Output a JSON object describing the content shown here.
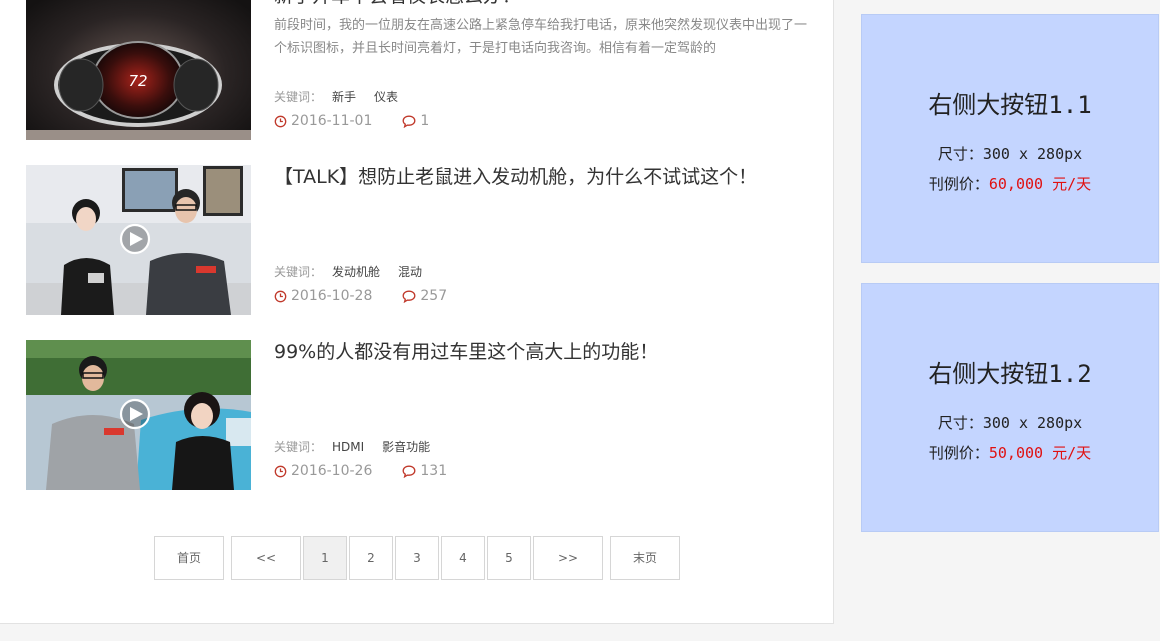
{
  "articles": [
    {
      "title": "新手开车不会看仪表怎么办？",
      "summary": "前段时间，我的一位朋友在高速公路上紧急停车给我打电话，原来他突然发现仪表中出现了一个标识图标，并且长时间亮着灯，于是打电话向我咨询。相信有着一定驾龄的",
      "keywords_label": "关键词：",
      "keywords": [
        "新手",
        "仪表"
      ],
      "date": "2016-11-01",
      "comments": "1",
      "speedo": "72"
    },
    {
      "title": "【TALK】想防止老鼠进入发动机舱，为什么不试试这个！",
      "summary": "",
      "keywords_label": "关键词：",
      "keywords": [
        "发动机舱",
        "混动"
      ],
      "date": "2016-10-28",
      "comments": "257"
    },
    {
      "title": "99%的人都没有用过车里这个高大上的功能！",
      "summary": "",
      "keywords_label": "关键词：",
      "keywords": [
        "HDMI",
        "影音功能"
      ],
      "date": "2016-10-26",
      "comments": "131"
    }
  ],
  "pagination": {
    "first": "首页",
    "prev": "<<",
    "pages": [
      "1",
      "2",
      "3",
      "4",
      "5"
    ],
    "current": "1",
    "next": ">>",
    "last": "末页"
  },
  "ads": [
    {
      "title": "右侧大按钮1.1",
      "size_label": "尺寸：300 x 280px",
      "price_label": "刊例价：",
      "price_value": "60,000 元/天"
    },
    {
      "title": "右侧大按钮1.2",
      "size_label": "尺寸：300 x 280px",
      "price_label": "刊例价：",
      "price_value": "50,000 元/天"
    }
  ],
  "colors": {
    "ad_background": "#c4d5ff",
    "price_red": "#e01010",
    "meta_icon_red": "#c0392b"
  },
  "icons": {
    "clock": "clock-icon",
    "comment": "comment-icon",
    "play": "play-icon"
  }
}
